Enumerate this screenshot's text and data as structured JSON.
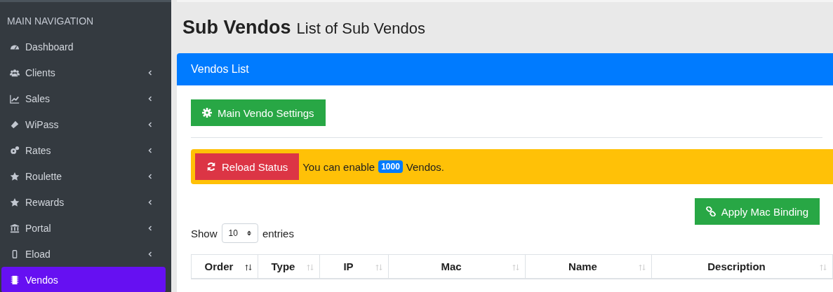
{
  "sidebar": {
    "heading": "MAIN NAVIGATION",
    "items": [
      {
        "label": "Dashboard",
        "expandable": false,
        "selected": false
      },
      {
        "label": "Clients",
        "expandable": true,
        "selected": false
      },
      {
        "label": "Sales",
        "expandable": true,
        "selected": false
      },
      {
        "label": "WiPass",
        "expandable": true,
        "selected": false
      },
      {
        "label": "Rates",
        "expandable": true,
        "selected": false
      },
      {
        "label": "Roulette",
        "expandable": true,
        "selected": false
      },
      {
        "label": "Rewards",
        "expandable": true,
        "selected": false
      },
      {
        "label": "Portal",
        "expandable": true,
        "selected": false
      },
      {
        "label": "Eload",
        "expandable": true,
        "selected": false
      },
      {
        "label": "Vendos",
        "expandable": false,
        "selected": true
      }
    ]
  },
  "page": {
    "title": "Sub Vendos",
    "subtitle": "List of Sub Vendos"
  },
  "card": {
    "title": "Vendos List",
    "settings_button": "Main Vendo Settings",
    "alert": {
      "button": "Reload Status",
      "text_before": "You can enable",
      "badge": "1000",
      "text_after": "Vendos."
    },
    "mac_button": "Apply Mac Binding",
    "length": {
      "before": "Show",
      "value": "10",
      "after": "entries"
    },
    "table": {
      "columns": [
        {
          "label": "Order",
          "sorted": true
        },
        {
          "label": "Type",
          "sorted": false
        },
        {
          "label": "IP",
          "sorted": false
        },
        {
          "label": "Mac",
          "sorted": false
        },
        {
          "label": "Name",
          "sorted": false
        },
        {
          "label": "Description",
          "sorted": false
        }
      ]
    }
  }
}
